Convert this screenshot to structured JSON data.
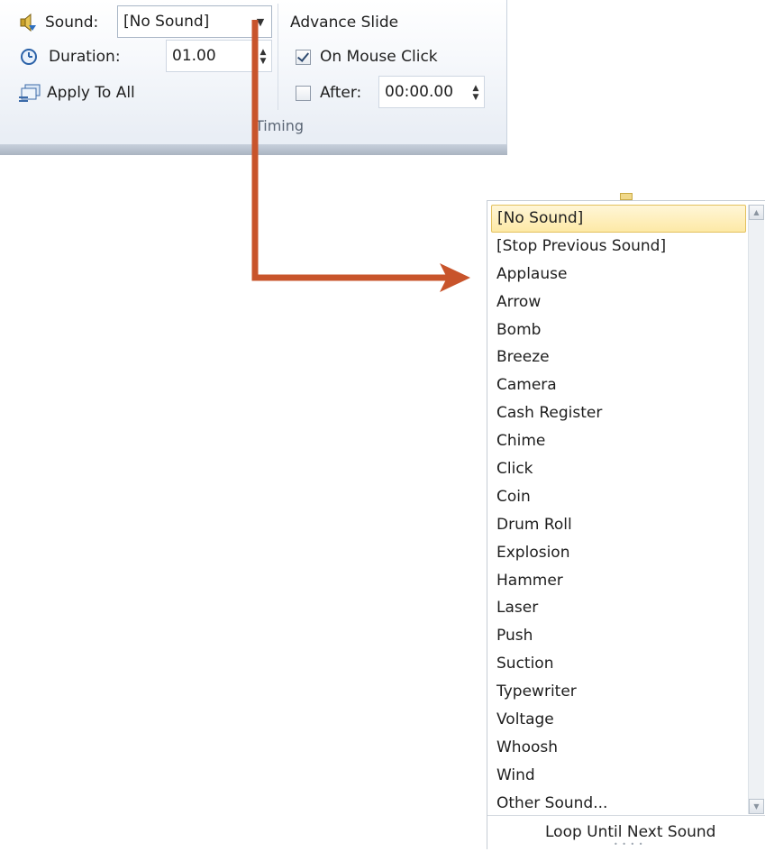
{
  "ribbon": {
    "sound_label": "Sound:",
    "sound_value": "[No Sound]",
    "duration_label": "Duration:",
    "duration_value": "01.00",
    "apply_to_all_label": "Apply To All",
    "advance_slide_label": "Advance Slide",
    "on_mouse_click_label": "On Mouse Click",
    "on_mouse_click_checked": true,
    "after_label": "After:",
    "after_checked": false,
    "after_value": "00:00.00",
    "group_label": "Timing"
  },
  "sound_menu": {
    "items": [
      "[No Sound]",
      "[Stop Previous Sound]",
      "Applause",
      "Arrow",
      "Bomb",
      "Breeze",
      "Camera",
      "Cash Register",
      "Chime",
      "Click",
      "Coin",
      "Drum Roll",
      "Explosion",
      "Hammer",
      "Laser",
      "Push",
      "Suction",
      "Typewriter",
      "Voltage",
      "Whoosh",
      "Wind",
      "Other Sound..."
    ],
    "selected_index": 0,
    "loop_label": "Loop Until Next Sound"
  },
  "colors": {
    "arrow": "#c8542b",
    "selection_fill": "#fde9a6",
    "selection_border": "#e3c15e"
  }
}
